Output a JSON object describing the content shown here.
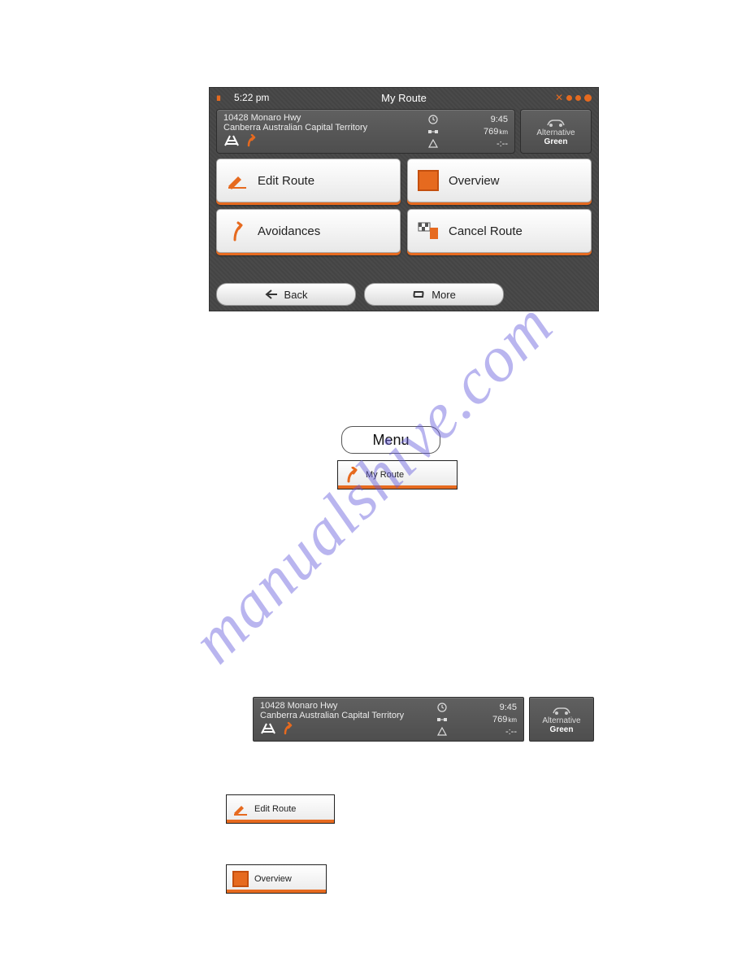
{
  "watermark": "manualshive.com",
  "device": {
    "status": {
      "time": "5:22 pm",
      "title": "My Route"
    },
    "info": {
      "addr1": "10428 Monaro Hwy",
      "addr2": "Canberra Australian Capital Territory",
      "eta": "9:45",
      "dist_val": "769",
      "dist_unit": "km",
      "warn": "-:--",
      "alt_label": "Alternative",
      "alt_value": "Green"
    },
    "buttons": {
      "edit": "Edit Route",
      "overview": "Overview",
      "avoid": "Avoidances",
      "cancel": "Cancel Route"
    },
    "bottom": {
      "back": "Back",
      "more": "More"
    }
  },
  "mid": {
    "menu": "Menu",
    "myroute": "My Route"
  },
  "small": {
    "edit": "Edit Route",
    "overview": "Overview"
  }
}
